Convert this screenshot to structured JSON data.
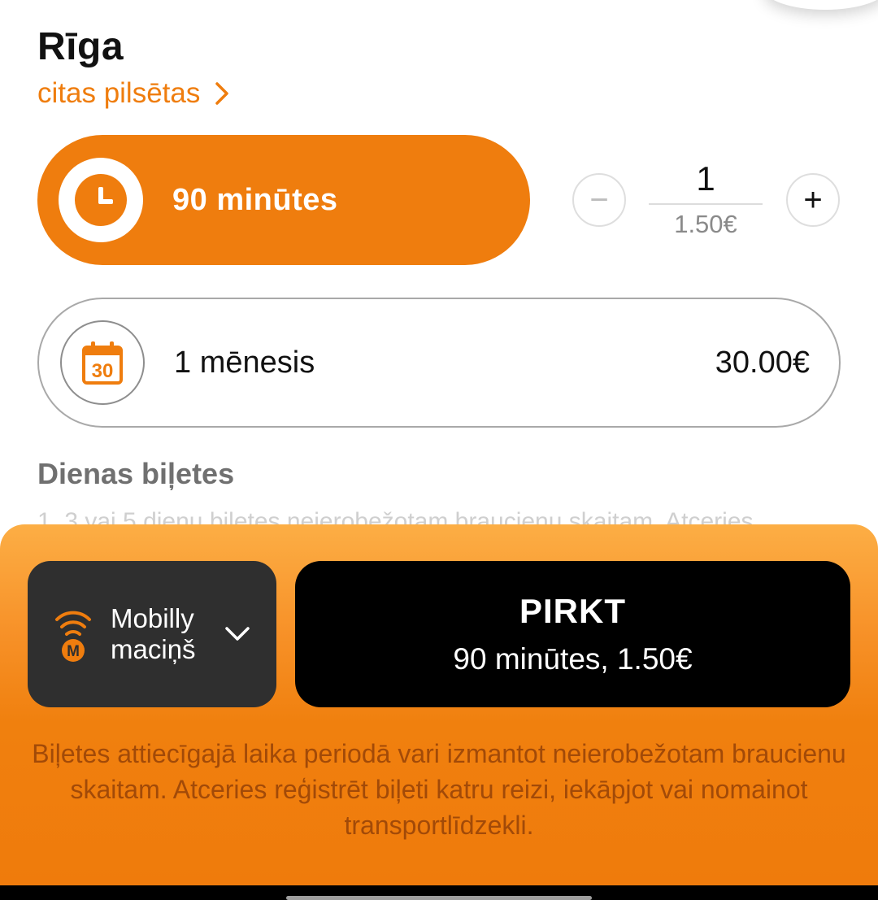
{
  "header": {
    "city": "Rīga",
    "other_cities_link": "citas pilsētas"
  },
  "tickets": {
    "selected": {
      "label": "90 minūtes",
      "icon": "clock-icon"
    },
    "stepper": {
      "quantity": "1",
      "unit_price": "1.50€",
      "minus": "−",
      "plus": "+"
    },
    "month": {
      "label": "1 mēnesis",
      "price": "30.00€",
      "icon": "calendar-30-icon",
      "calendar_day": "30"
    }
  },
  "day_tickets": {
    "title": "Dienas biļetes",
    "description": "1, 3 vai 5 dienu biļetes neierobežotam braucienu skaitam. Atceries"
  },
  "purchase": {
    "wallet": {
      "line1": "Mobilly",
      "line2": "maciņš",
      "icon": "mobilly-wallet-icon",
      "logo_letter": "M"
    },
    "buy_title": "PIRKT",
    "buy_subtitle": "90 minūtes, 1.50€",
    "notice": "Biļetes attiecīgajā laika periodā vari izmantot neierobežotam braucienu skaitam. Atceries reģistrēt biļeti katru reizi, iekāpjot vai nomainot transportlīdzekli."
  },
  "colors": {
    "accent": "#ef7d0e",
    "dark_button": "#000000",
    "wallet_bg": "#2f2f2f",
    "notice_text": "#a24a08"
  }
}
